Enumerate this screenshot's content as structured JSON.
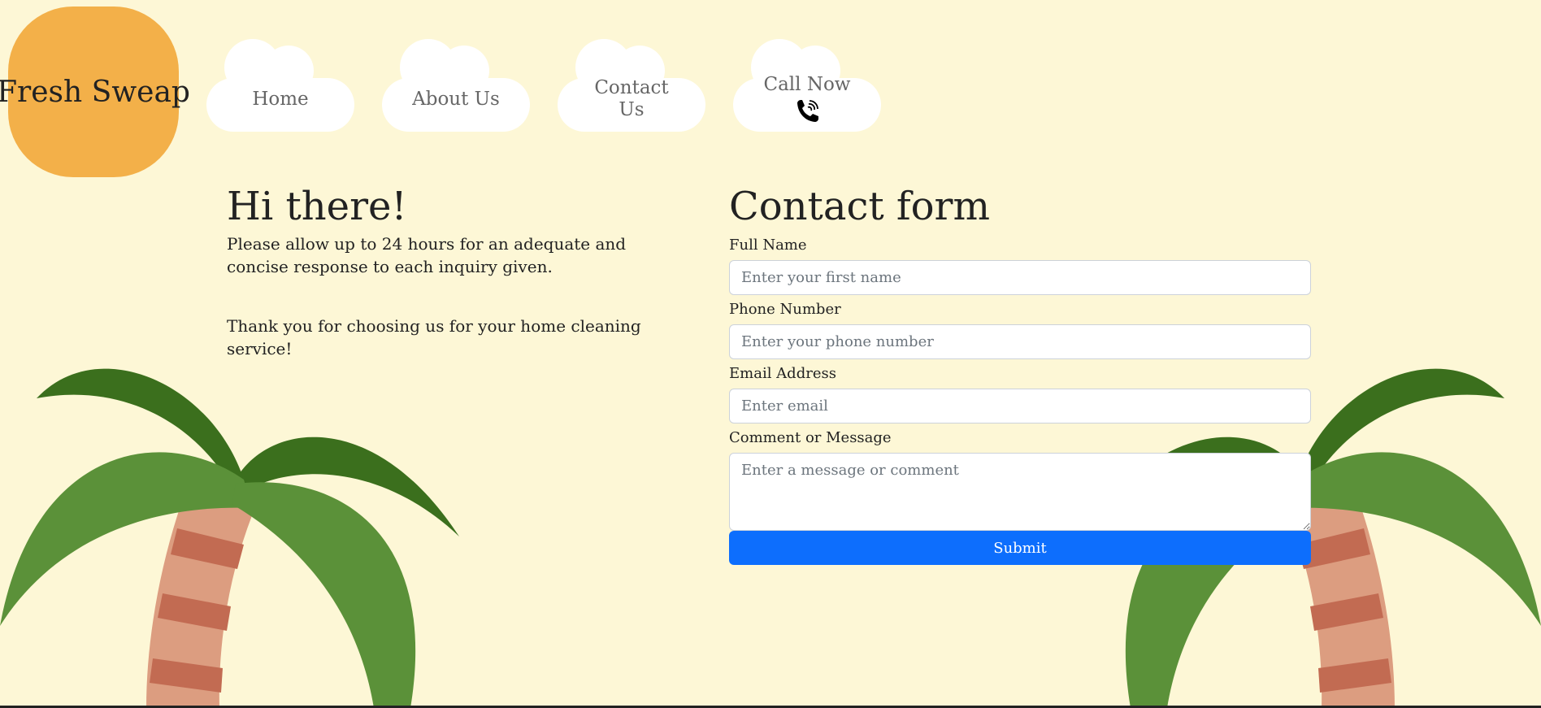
{
  "brand": {
    "name": "Fresh Sweap",
    "color": "#f3b049"
  },
  "nav": {
    "home": "Home",
    "about": "About Us",
    "contact_line1": "Contact",
    "contact_line2": "Us",
    "call": "Call Now",
    "call_icon": "phone-icon"
  },
  "intro": {
    "title": "Hi there!",
    "paragraph1": "Please allow up to 24 hours for an adequate and concise response to each inquiry given.",
    "paragraph2": "Thank you for choosing us for your home cleaning service!"
  },
  "form": {
    "title": "Contact form",
    "full_name_label": "Full Name",
    "full_name_placeholder": "Enter your first name",
    "phone_label": "Phone Number",
    "phone_placeholder": "Enter your phone number",
    "email_label": "Email Address",
    "email_placeholder": "Enter email",
    "message_label": "Comment or Message",
    "message_placeholder": "Enter a message or comment",
    "submit_label": "Submit",
    "accent": "#0d6efd"
  },
  "decor": {
    "background": "#fdf7d6",
    "palm_dark": "#3b6f1d",
    "palm_light": "#5b9139",
    "trunk": "#c26b52",
    "trunk_light": "#dc9d80"
  }
}
